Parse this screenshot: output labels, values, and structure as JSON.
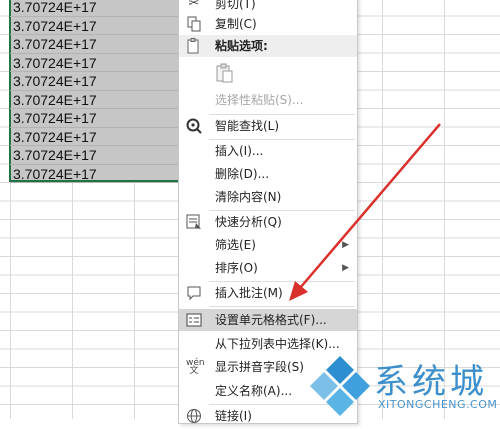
{
  "sheet": {
    "cells": [
      "3.70724E+17",
      "3.70724E+17",
      "3.70724E+17",
      "3.70724E+17",
      "3.70724E+17",
      "3.70724E+17",
      "3.70724E+17",
      "3.70724E+17",
      "3.70724E+17",
      "3.70724E+17"
    ]
  },
  "menu": {
    "cut": "剪切(T)",
    "copy": "复制(C)",
    "paste_options": "粘贴选项:",
    "paste_special": "选择性粘贴(S)...",
    "smart_lookup": "智能查找(L)",
    "insert": "插入(I)...",
    "delete": "删除(D)...",
    "clear_contents": "清除内容(N)",
    "quick_analysis": "快速分析(Q)",
    "filter": "筛选(E)",
    "sort": "排序(O)",
    "insert_comment": "插入批注(M)",
    "format_cells": "设置单元格格式(F)...",
    "pick_from_list": "从下拉列表中选择(K)...",
    "phonetic": "显示拼音字段(S)",
    "define_name": "定义名称(A)...",
    "link": "链接(I)",
    "submenu_arrow": "▶",
    "accent": "#d6d6d6"
  },
  "watermark": {
    "name": "系统城",
    "url": "XITONGCHENG.COM",
    "color": "#3d8fcb"
  },
  "arrow_color": "#d9302c"
}
